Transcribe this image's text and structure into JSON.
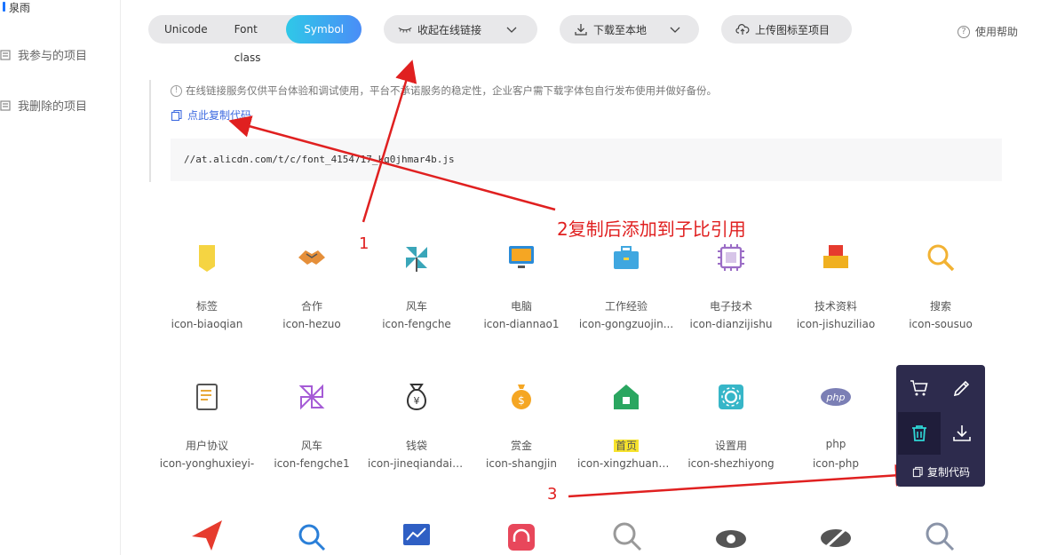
{
  "sidebar": {
    "top_label": "泉雨",
    "items": [
      {
        "label": "我参与的项目"
      },
      {
        "label": "我删除的项目"
      }
    ]
  },
  "toolbar": {
    "tabs": [
      "Unicode",
      "Font class",
      "Symbol"
    ],
    "active_tab": "Symbol",
    "collapse_label": "收起在线链接",
    "download_label": "下载至本地",
    "upload_label": "上传图标至项目",
    "help_label": "使用帮助"
  },
  "notice": {
    "text": "在线链接服务仅供平台体验和调试使用，平台不承诺服务的稳定性，企业客户需下载字体包自行发布使用并做好备份。",
    "copy_link": "点此复制代码",
    "code": "//at.alicdn.com/t/c/font_4154717_kg0jhmar4b.js"
  },
  "annotations": {
    "label_2": "2复制后添加到子比引用",
    "num_1": "1",
    "num_3": "3"
  },
  "icons": [
    {
      "name": "标签",
      "code": "icon-biaoqian",
      "color": "#f5d442"
    },
    {
      "name": "合作",
      "code": "icon-hezuo",
      "color": "#e58f3a"
    },
    {
      "name": "风车",
      "code": "icon-fengche",
      "color": "#3aa6b9"
    },
    {
      "name": "电脑",
      "code": "icon-diannao1",
      "color": "#2a8bd8"
    },
    {
      "name": "工作经验",
      "code": "icon-gongzuojin...",
      "color": "#3fa7e0"
    },
    {
      "name": "电子技术",
      "code": "icon-dianzijishu",
      "color": "#9b6dc6"
    },
    {
      "name": "技术资料",
      "code": "icon-jishuziliao",
      "color": "#f0b020"
    },
    {
      "name": "搜索",
      "code": "icon-sousuo",
      "color": "#f2b233"
    },
    {
      "name": "用户协议",
      "code": "icon-yonghuxieyi-",
      "color": "#e8a93a"
    },
    {
      "name": "风车",
      "code": "icon-fengche1",
      "color": "#a55bd6"
    },
    {
      "name": "钱袋",
      "code": "icon-jineqiandaiy...",
      "color": "#333333"
    },
    {
      "name": "赏金",
      "code": "icon-shangjin",
      "color": "#f5a623"
    },
    {
      "name": "首页",
      "code": "icon-xingzhuang...",
      "color": "#2aa660"
    },
    {
      "name": "设置用",
      "code": "icon-shezhiyong",
      "color": "#37b6c8"
    },
    {
      "name": "php",
      "code": "icon-php",
      "color": "#7b7fb5"
    }
  ],
  "popup": {
    "copy_label": "复制代码"
  }
}
